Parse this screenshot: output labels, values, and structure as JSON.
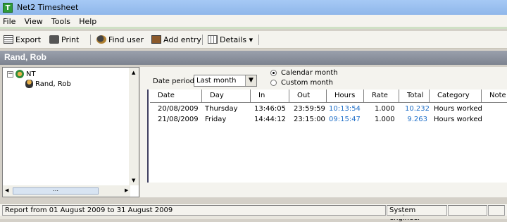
{
  "window": {
    "title": "Net2 Timesheet",
    "app_icon_letter": "T"
  },
  "menu": [
    "File",
    "View",
    "Tools",
    "Help"
  ],
  "toolbar": {
    "export_label": "Export",
    "print_label": "Print",
    "find_user_label": "Find user",
    "add_entry_label": "Add entry",
    "details_label": "Details ▾"
  },
  "header": {
    "user_name": "Rand, Rob"
  },
  "tree": {
    "root_label": "NT",
    "child_label": "Rand, Rob",
    "root_expander": "−"
  },
  "filter": {
    "date_period_label": "Date period",
    "date_period_value": "Last month",
    "radio_calendar": "Calendar month",
    "radio_custom": "Custom month",
    "selected": "calendar"
  },
  "table": {
    "columns": [
      "Date",
      "Day",
      "In",
      "Out",
      "Hours",
      "Rate",
      "Total",
      "Category",
      "Note"
    ],
    "rows": [
      [
        "20/08/2009",
        "Thursday",
        "13:46:05",
        "23:59:59",
        "10:13:54",
        "1.000",
        "10.232",
        "Hours worked",
        ""
      ],
      [
        "21/08/2009",
        "Friday",
        "14:44:12",
        "23:15:00",
        "09:15:47",
        "1.000",
        "9.263",
        "Hours worked",
        ""
      ]
    ]
  },
  "status": {
    "report_range": "Report from 01 August 2009 to 31 August 2009",
    "role": "System engineer"
  },
  "colors": {
    "accent_link": "#1f6fc8",
    "header_bar": "#8a909c"
  }
}
